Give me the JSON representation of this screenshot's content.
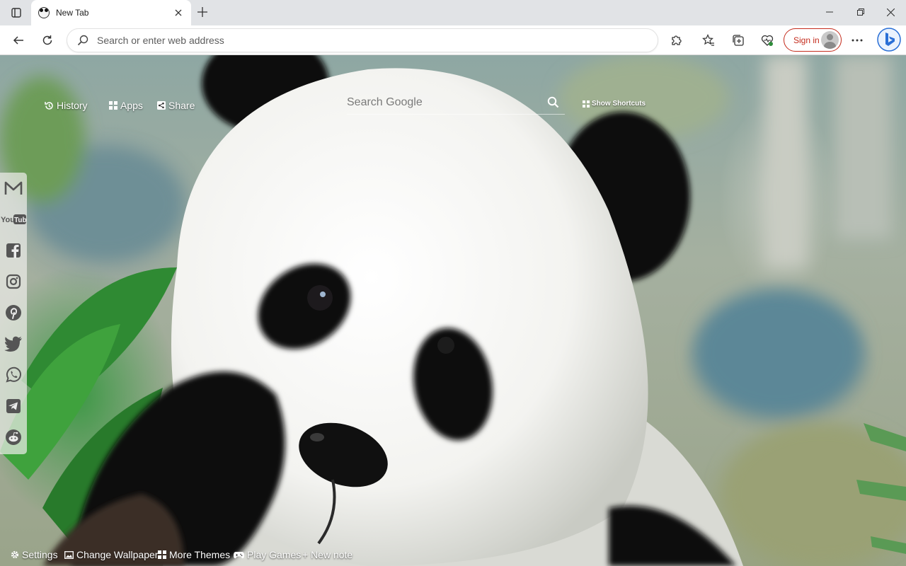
{
  "browser": {
    "tab": {
      "title": "New Tab"
    },
    "address_bar": {
      "placeholder": "Search or enter web address",
      "value": ""
    },
    "sign_in_label": "Sign in"
  },
  "newtab": {
    "links": {
      "history": "History",
      "apps": "Apps",
      "share": "Share"
    },
    "search": {
      "placeholder": "Search Google"
    },
    "show_shortcuts": "Show Shortcuts",
    "social": [
      {
        "name": "gmail-icon"
      },
      {
        "name": "youtube-icon",
        "label": "You Tube"
      },
      {
        "name": "facebook-icon"
      },
      {
        "name": "instagram-icon"
      },
      {
        "name": "pinterest-icon"
      },
      {
        "name": "twitter-icon"
      },
      {
        "name": "whatsapp-icon"
      },
      {
        "name": "telegram-icon"
      },
      {
        "name": "reddit-icon"
      }
    ],
    "bottom": {
      "settings": "Settings",
      "change_wallpaper": "Change Wallpaper",
      "more_themes": "More Themes",
      "play_games": "Play Games",
      "new_note": "+ New note"
    }
  },
  "colors": {
    "sign_in_accent": "#c42b1c",
    "bing_blue": "#2a6fd6"
  }
}
